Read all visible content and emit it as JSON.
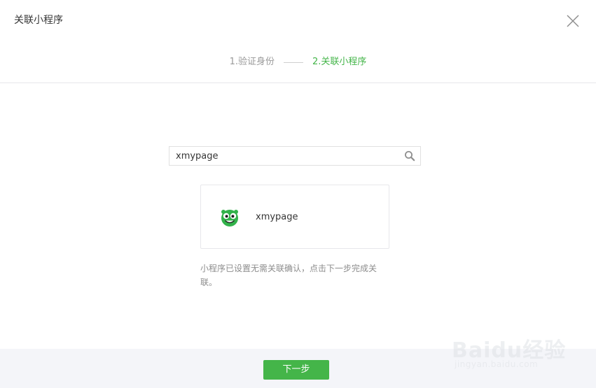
{
  "dialog": {
    "title": "关联小程序"
  },
  "steps": {
    "step1": "1.验证身份",
    "step2": "2.关联小程序"
  },
  "search": {
    "value": "xmypage",
    "placeholder": ""
  },
  "result": {
    "name": "xmypage",
    "avatar_icon": "frog-mascot-icon"
  },
  "hint": "小程序已设置无需关联确认，点击下一步完成关联。",
  "footer": {
    "next_label": "下一步"
  },
  "watermark": {
    "brand": "Baidu经验",
    "url": "jingyan.baidu.com"
  },
  "colors": {
    "accent": "#44b549",
    "muted": "#9a9a9a",
    "text": "#353535",
    "footer_bg": "#f4f5f9"
  }
}
